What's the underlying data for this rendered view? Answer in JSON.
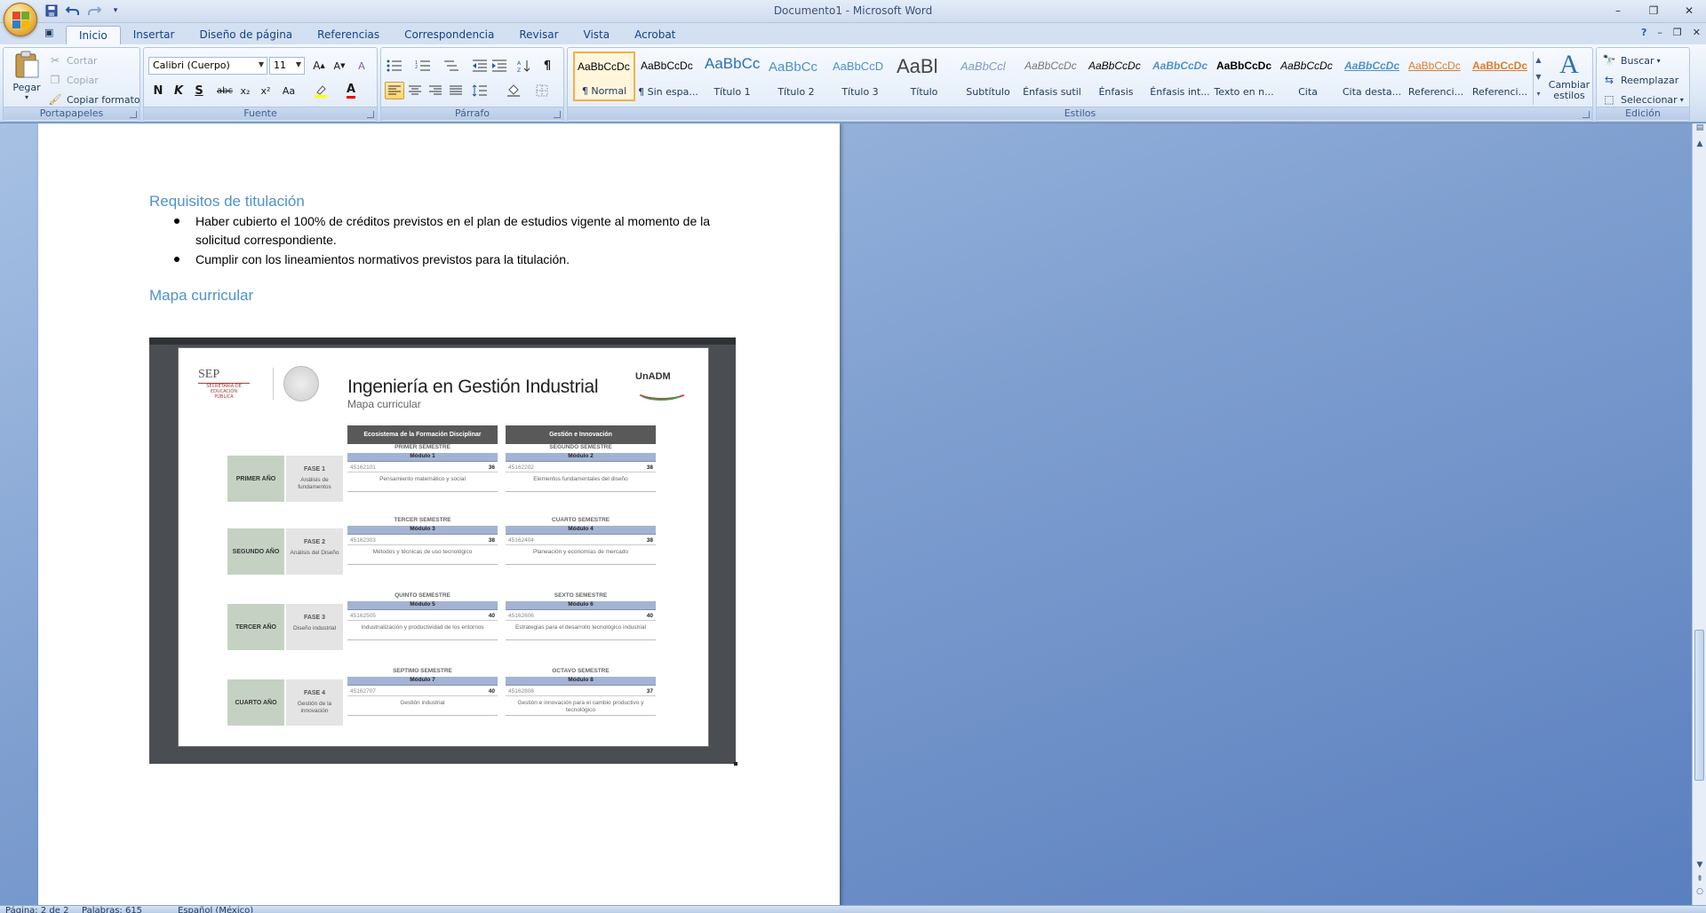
{
  "window": {
    "title": "Documento1 - Microsoft Word"
  },
  "quick_access": {
    "items": [
      "save-icon",
      "undo-icon",
      "redo-icon",
      "customize-icon"
    ]
  },
  "tabs": [
    {
      "label": "Inicio",
      "active": true
    },
    {
      "label": "Insertar"
    },
    {
      "label": "Diseño de página"
    },
    {
      "label": "Referencias"
    },
    {
      "label": "Correspondencia"
    },
    {
      "label": "Revisar"
    },
    {
      "label": "Vista"
    },
    {
      "label": "Acrobat"
    }
  ],
  "ribbon": {
    "clipboard": {
      "label": "Portapapeles",
      "paste": "Pegar",
      "cut": "Cortar",
      "copy": "Copiar",
      "format_painter": "Copiar formato"
    },
    "font": {
      "label": "Fuente",
      "font_name": "Calibri (Cuerpo)",
      "font_size": "11",
      "bold": "N",
      "italic": "K",
      "underline": "S",
      "strikethrough": "abc",
      "subscript": "x₂",
      "superscript": "x²",
      "change_case": "Aa"
    },
    "paragraph": {
      "label": "Párrafo"
    },
    "styles": {
      "label": "Estilos",
      "items": [
        {
          "sample": "AaBbCcDc",
          "name": "¶ Normal",
          "selected": true
        },
        {
          "sample": "AaBbCcDc",
          "name": "¶ Sin espa..."
        },
        {
          "sample": "AaBbCc",
          "name": "Título 1"
        },
        {
          "sample": "AaBbCc",
          "name": "Título 2"
        },
        {
          "sample": "AaBbCcD",
          "name": "Título 3"
        },
        {
          "sample": "AaBl",
          "name": "Título"
        },
        {
          "sample": "AaBbCcl",
          "name": "Subtítulo"
        },
        {
          "sample": "AaBbCcDc",
          "name": "Énfasis sutil"
        },
        {
          "sample": "AaBbCcDc",
          "name": "Énfasis"
        },
        {
          "sample": "AaBbCcDc",
          "name": "Énfasis int..."
        },
        {
          "sample": "AaBbCcDc",
          "name": "Texto en n..."
        },
        {
          "sample": "AaBbCcDc",
          "name": "Cita"
        },
        {
          "sample": "AaBbCcDc",
          "name": "Cita desta..."
        },
        {
          "sample": "AaBbCcDc",
          "name": "Referenci..."
        },
        {
          "sample": "AaBbCcDc",
          "name": "Referenci..."
        }
      ],
      "change_styles": "Cambiar estilos"
    },
    "editing": {
      "label": "Edición",
      "find": "Buscar",
      "replace": "Reemplazar",
      "select": "Seleccionar"
    }
  },
  "document": {
    "heading1": "Requisitos de titulación",
    "bullets": [
      "Haber cubierto el 100% de créditos previstos en el plan de estudios vigente al momento de la solicitud correspondiente.",
      "Cumplir con los lineamientos normativos previstos para la titulación."
    ],
    "heading2": "Mapa curricular",
    "image": {
      "sep": "SEP",
      "sep_sub": "SECRETARÍA DE EDUCACIÓN PÚBLICA",
      "title": "Ingeniería en Gestión Industrial",
      "subtitle": "Mapa curricular",
      "unadm": "UnADM",
      "col1": "Ecosistema de la Formación Disciplinar",
      "col2": "Gestión e Innovación",
      "years": [
        "PRIMER AÑO",
        "SEGUNDO AÑO",
        "TERCER AÑO",
        "CUARTO AÑO"
      ],
      "phases": [
        {
          "n": "FASE 1",
          "d": "Análisis de fundamentos"
        },
        {
          "n": "FASE 2",
          "d": "Análisis del Diseño"
        },
        {
          "n": "FASE 3",
          "d": "Diseño industrial"
        },
        {
          "n": "FASE 4",
          "d": "Gestión de la innovación"
        }
      ],
      "modules": [
        {
          "sem": "PRIMER SEMESTRE",
          "mod": "Módulo 1",
          "code": "45162101",
          "cred": "36",
          "subj": "Pensamiento matemático y social"
        },
        {
          "sem": "SEGUNDO SEMESTRE",
          "mod": "Módulo 2",
          "code": "45162202",
          "cred": "38",
          "subj": "Elementos fundamentales del diseño"
        },
        {
          "sem": "TERCER SEMESTRE",
          "mod": "Módulo 3",
          "code": "45162303",
          "cred": "38",
          "subj": "Métodos y técnicas de uso tecnológico"
        },
        {
          "sem": "CUARTO SEMESTRE",
          "mod": "Módulo 4",
          "code": "45162404",
          "cred": "38",
          "subj": "Planeación y economías de mercado"
        },
        {
          "sem": "QUINTO SEMESTRE",
          "mod": "Módulo 5",
          "code": "45162505",
          "cred": "40",
          "subj": "Industrialización y productividad de los entornos"
        },
        {
          "sem": "SEXTO SEMESTRE",
          "mod": "Módulo 6",
          "code": "45162606",
          "cred": "40",
          "subj": "Estrategias para el desarrollo tecnológico industrial"
        },
        {
          "sem": "SEPTIMO SEMESTRE",
          "mod": "Módulo 7",
          "code": "45162707",
          "cred": "40",
          "subj": "Gestión industrial"
        },
        {
          "sem": "OCTAVO SEMESTRE",
          "mod": "Módulo 8",
          "code": "45162808",
          "cred": "37",
          "subj": "Gestión e innovación para el cambio productivo y tecnológico"
        }
      ]
    }
  },
  "status": {
    "page": "Página: 2 de 2",
    "words": "Palabras: 615",
    "language": "Español (México)"
  }
}
